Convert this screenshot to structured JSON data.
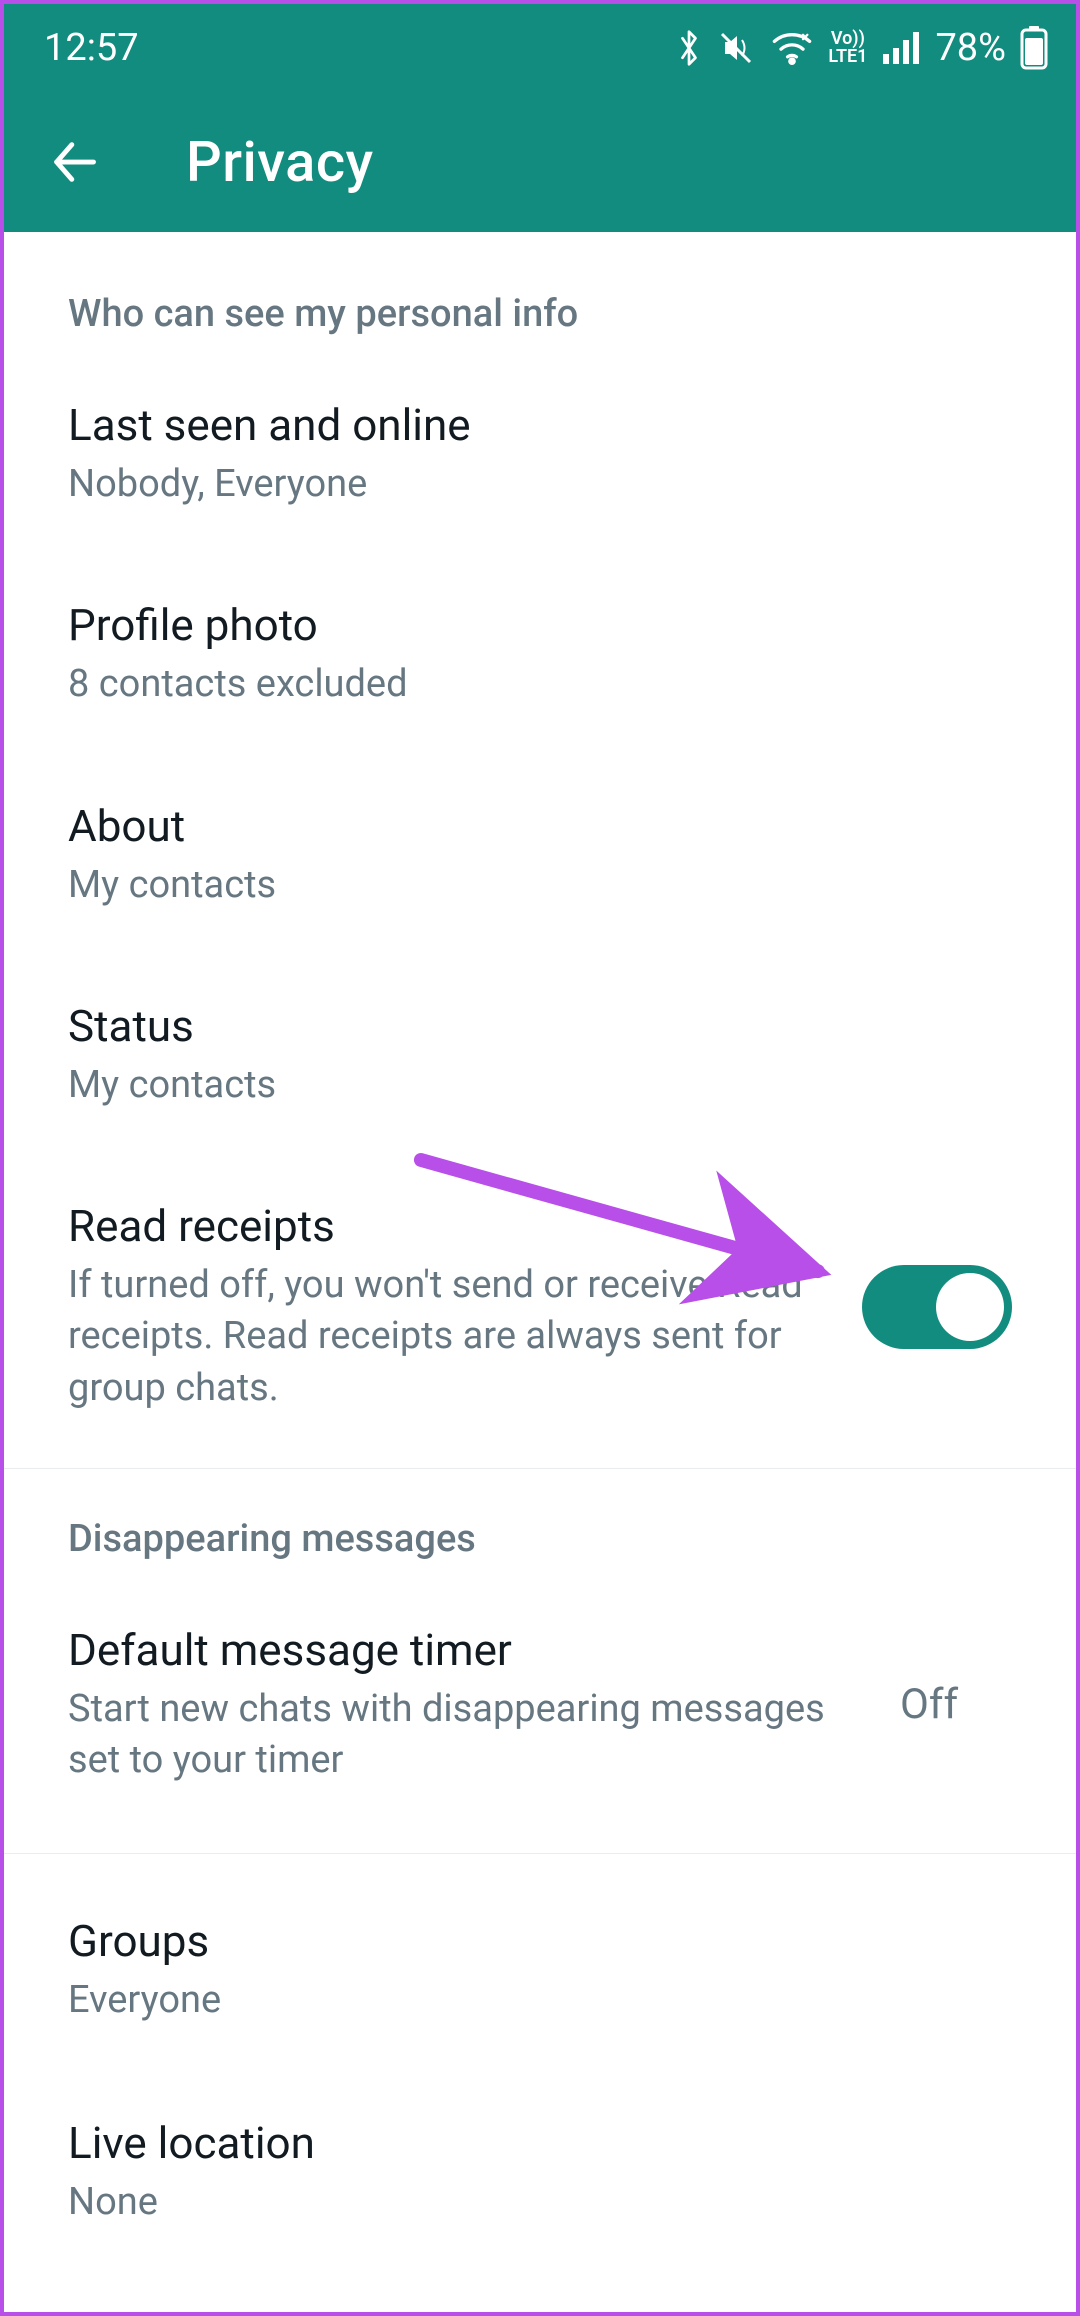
{
  "statusbar": {
    "time": "12:57",
    "battery_text": "78%"
  },
  "appbar": {
    "title": "Privacy"
  },
  "sections": {
    "personal_info_header": "Who can see my personal info",
    "last_seen": {
      "title": "Last seen and online",
      "subtitle": "Nobody, Everyone"
    },
    "profile_photo": {
      "title": "Profile photo",
      "subtitle": "8 contacts excluded"
    },
    "about": {
      "title": "About",
      "subtitle": "My contacts"
    },
    "status": {
      "title": "Status",
      "subtitle": "My contacts"
    },
    "read_receipts": {
      "title": "Read receipts",
      "subtitle": "If turned off, you won't send or receive Read receipts. Read receipts are always sent for group chats.",
      "toggle": true
    },
    "disappearing_header": "Disappearing messages",
    "default_timer": {
      "title": "Default message timer",
      "subtitle": "Start new chats with disappearing messages set to your timer",
      "value": "Off"
    },
    "groups": {
      "title": "Groups",
      "subtitle": "Everyone"
    },
    "live_location": {
      "title": "Live location",
      "subtitle": "None"
    }
  },
  "annotation": {
    "arrow_color": "#b84fe8"
  }
}
